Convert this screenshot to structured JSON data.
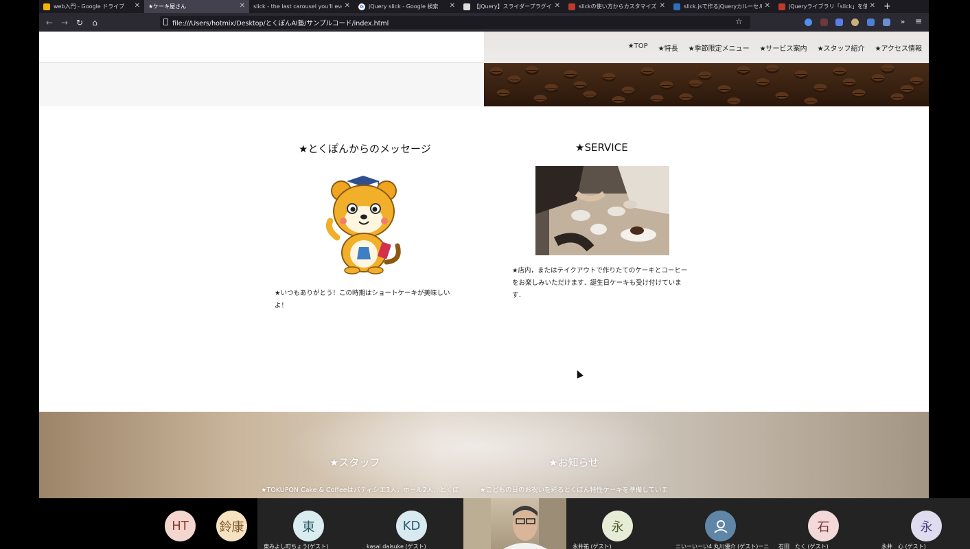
{
  "tabs": [
    {
      "title": "web入門 - Google ドライブ",
      "icon_color": "#f4b400",
      "active": false
    },
    {
      "title": "★ケーキ屋さん",
      "icon_color": "",
      "active": true
    },
    {
      "title": "slick - the last carousel you'll ever n",
      "icon_color": "",
      "active": false
    },
    {
      "title": "jQuery slick - Google 検索",
      "icon_color": "#4285f4",
      "active": false
    },
    {
      "title": "【jQuery】スライダープラグイン",
      "icon_color": "#555555",
      "active": false
    },
    {
      "title": "slickの使い方からカスタマイズま",
      "icon_color": "#c0392b",
      "active": false
    },
    {
      "title": "slick.jsで作るjQueryカルーセルス",
      "icon_color": "#2c6fbb",
      "active": false
    },
    {
      "title": "jQueryライブラリ「slick」を使っ",
      "icon_color": "#c0392b",
      "active": false
    }
  ],
  "url": "file:///Users/hotmix/Desktop/とくぽんAI塾/サンプルコード/index.html",
  "nav": [
    "★TOP",
    "★特長",
    "★季節限定メニュー",
    "★サービス案内",
    "★スタッフ紹介",
    "★アクセス情報"
  ],
  "message": {
    "title": "★とくぽんからのメッセージ",
    "text": "★いつもありがとう！この時期はショートケーキが美味しいよ！"
  },
  "service": {
    "title": "★SERVICE",
    "text": "★店内，またはテイクアウトで作りたてのケーキとコーヒーをお楽しみいただけます．誕生日ケーキも受け付けています．"
  },
  "staff": {
    "title": "★スタッフ",
    "text": "★TOKUPON Cake & Coffeeはパティシエ3人，ホール2人，とくぽ"
  },
  "news": {
    "title": "★お知らせ",
    "text": "★こどもの日のお祝いを彩るとくぽん特性ケーキを準備していま"
  },
  "participants": [
    {
      "initials": "HT",
      "name": "",
      "bg": "#f3d6cf",
      "fg": "#8a3b2b"
    },
    {
      "initials": "鈴康",
      "name": "",
      "bg": "#f6e2c0",
      "fg": "#7a5a2a"
    },
    {
      "initials": "東",
      "name": "東みよし町ちょう(ゲスト)",
      "bg": "#d9ecef",
      "fg": "#2b5b66"
    },
    {
      "initials": "KD",
      "name": "kasai daisuke (ゲスト)",
      "bg": "#d8e9f0",
      "fg": "#2c5d73"
    },
    {
      "initials": "",
      "name": "",
      "bg": "",
      "fg": ""
    },
    {
      "initials": "永",
      "name": "永井祐 (ゲスト)",
      "bg": "#e6ecd6",
      "fg": "#50602d"
    },
    {
      "initials": "",
      "name": "ニいーいーい4 丸川優介 (ゲスト)ーニ",
      "bg": "#5f86a6",
      "fg": "#ffffff"
    },
    {
      "initials": "石",
      "name": "石田　たく (ゲスト)",
      "bg": "#f3d9d9",
      "fg": "#7a3333"
    },
    {
      "initials": "永",
      "name": "永井　心 (ゲスト)",
      "bg": "#e0dcef",
      "fg": "#4a3f80"
    }
  ]
}
